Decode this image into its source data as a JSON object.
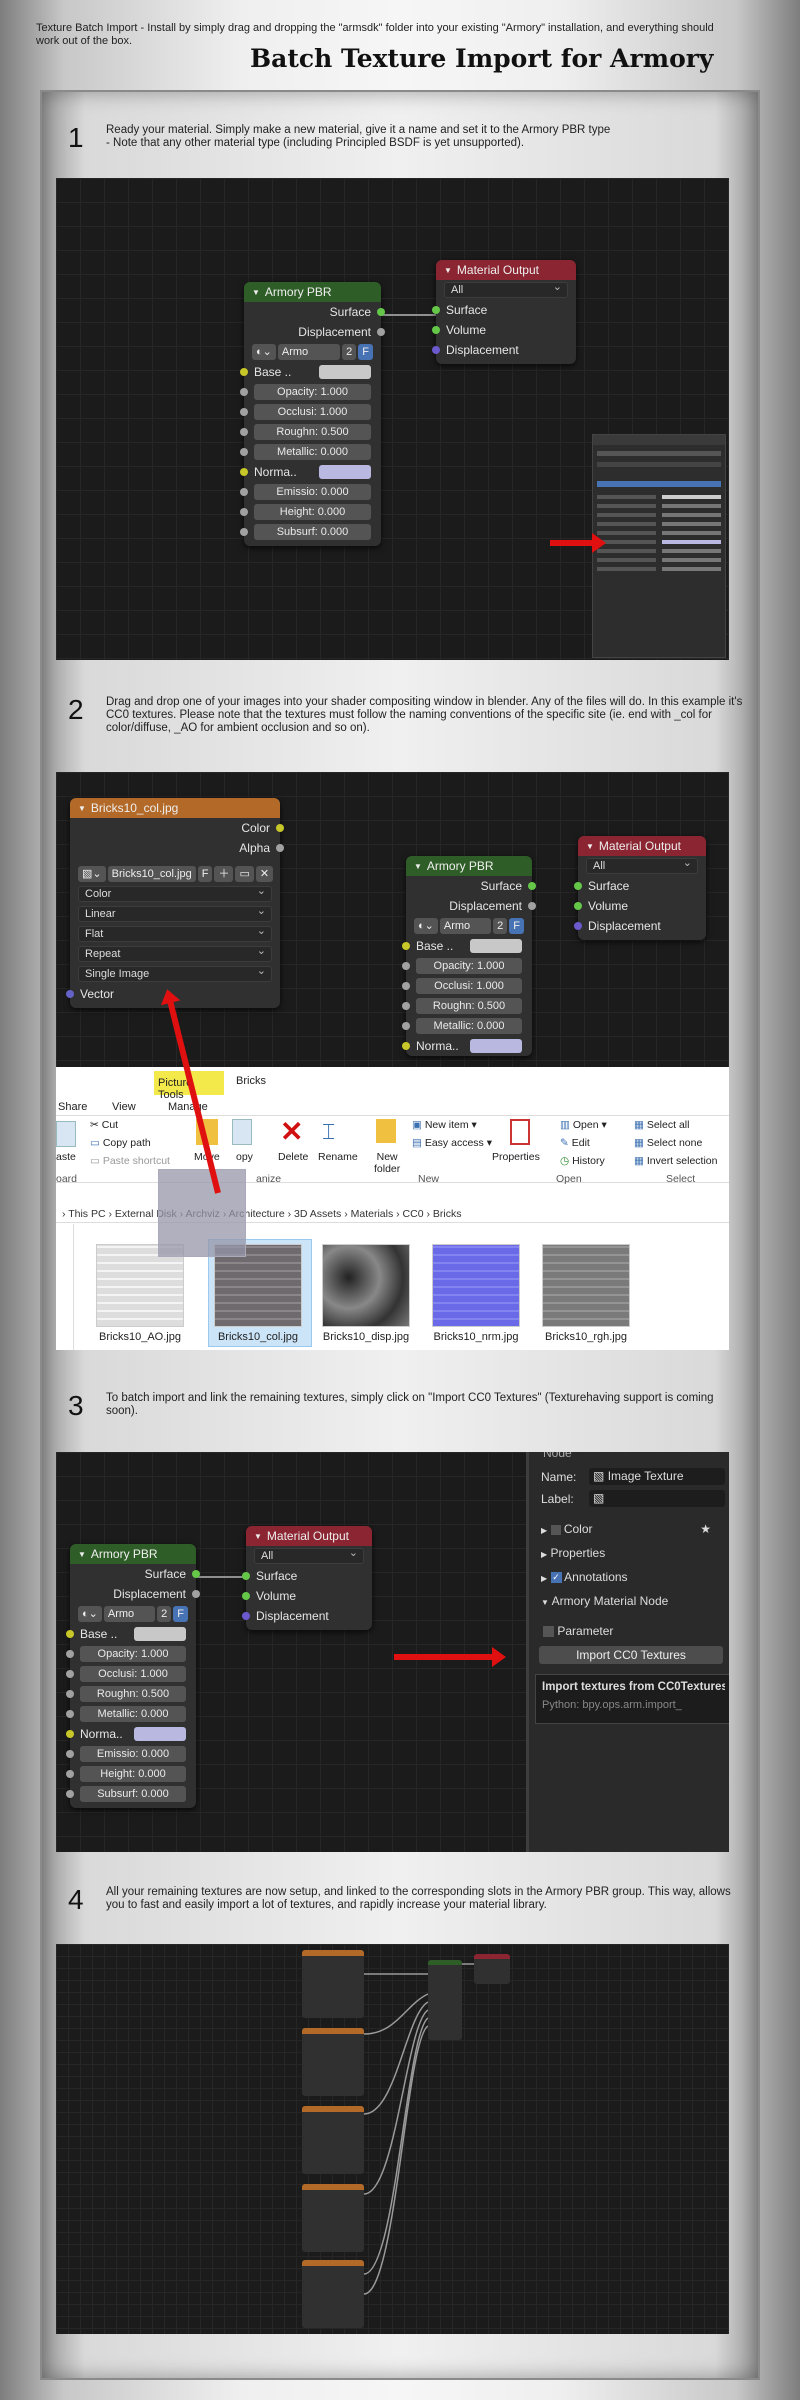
{
  "intro_text": "Texture Batch Import - Install by simply drag and dropping the \"armsdk\" folder into your existing \"Armory\" installation, and everything should work out of the box.",
  "page_title": "Batch Texture Import for Armory",
  "steps": [
    {
      "number": "1",
      "text": "Ready your material. Simply make a new material, give it a name and set it to the Armory PBR type\n - Note that any other material type (including Principled BSDF is yet unsupported)."
    },
    {
      "number": "2",
      "text": "Drag and drop one of your images into your shader compositing window in blender. Any of the files will do. In this example it's CC0 textures. Please note that the textures must follow the naming conventions of the specific site (ie. end with _col for color/diffuse, _AO for ambient occlusion and so on)."
    },
    {
      "number": "3",
      "text": "To batch import and link the remaining textures, simply click on \"Import CC0 Textures\" (Texturehaving support is coming soon)."
    },
    {
      "number": "4",
      "text": "All your remaining textures are now setup, and linked to the corresponding slots in the Armory PBR group. This way, allows you to fast and easily import a lot of textures, and rapidly increase your material library."
    }
  ],
  "armory_node": {
    "title": "Armory PBR",
    "outputs": [
      "Surface",
      "Displacement"
    ],
    "material_name": "Armo",
    "users": "2",
    "fake_user": "F",
    "base_label": "Base ..",
    "fields": [
      {
        "label": "Opacity:",
        "value": "1.000"
      },
      {
        "label": "Occlusi:",
        "value": "1.000"
      },
      {
        "label": "Roughn:",
        "value": "0.500"
      },
      {
        "label": "Metallic:",
        "value": "0.000"
      }
    ],
    "normal_label": "Norma..",
    "fields2": [
      {
        "label": "Emissio:",
        "value": "0.000"
      },
      {
        "label": "Height:",
        "value": "0.000"
      },
      {
        "label": "Subsurf:",
        "value": "0.000"
      }
    ]
  },
  "output_node": {
    "title": "Material Output",
    "target": "All",
    "inputs": [
      "Surface",
      "Volume",
      "Displacement"
    ]
  },
  "image_node": {
    "title": "Bricks10_col.jpg",
    "outputs": [
      "Color",
      "Alpha"
    ],
    "image_name": "Bricks10_col.jpg",
    "image_btn": "F",
    "dropdowns": [
      "Color",
      "Linear",
      "Flat",
      "Repeat",
      "Single Image"
    ],
    "vector_label": "Vector"
  },
  "explorer": {
    "tab_picture_tools": "Picture Tools",
    "tab_bricks": "Bricks",
    "tab_share": "Share",
    "tab_view": "View",
    "tab_manage": "Manage",
    "cut": "Cut",
    "copy_path": "Copy path",
    "paste_shortcut": "Paste shortcut",
    "paste": "aste",
    "move": "Move",
    "copy": "opy",
    "delete": "Delete",
    "rename": "Rename",
    "new_folder_1": "New",
    "new_folder_2": "folder",
    "new_item": "New item ▾",
    "easy_access": "Easy access ▾",
    "properties": "Properties",
    "open": "Open ▾",
    "edit": "Edit",
    "history": "History",
    "select_all": "Select all",
    "select_none": "Select none",
    "invert_selection": "Invert selection",
    "group_clipboard": "oard",
    "group_organize": "anize",
    "group_new": "New",
    "group_open": "Open",
    "group_select": "Select",
    "breadcrumb": "›  This PC  ›  External Disk  ›  Archviz  ›  Architecture  ›  3D Assets  ›  Materials  ›  CC0  ›  Bricks",
    "files": [
      "Bricks10_AO.jpg",
      "Bricks10_col.jpg",
      "Bricks10_disp.jpg",
      "Bricks10_nrm.jpg",
      "Bricks10_rgh.jpg"
    ]
  },
  "properties_panel": {
    "header": "Node",
    "name_label": "Name:",
    "name_value": "Image Texture",
    "label_label": "Label:",
    "color_section": "Color",
    "properties_section": "Properties",
    "annotations_section": "Annotations",
    "armory_section": "Armory Material Node",
    "parameter_label": "Parameter",
    "import_button": "Import CC0 Textures",
    "tooltip_title": "Import textures from CC0Textures",
    "tooltip_python": "Python: bpy.ops.arm.import_"
  },
  "colors": {
    "armory_header": "#2f5d27",
    "output_header": "#8a2531",
    "image_header": "#b36a28",
    "arrow": "#e01010",
    "explorer_highlight": "#f4e94a"
  }
}
